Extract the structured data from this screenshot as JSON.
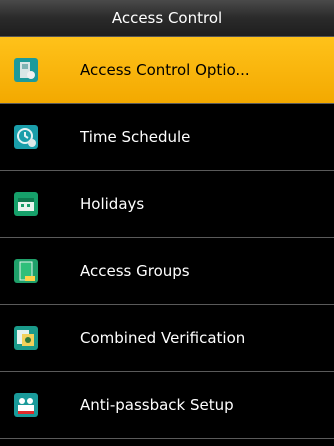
{
  "window": {
    "title": "Access Control"
  },
  "menu": {
    "items": [
      {
        "label": "Access Control Optio...",
        "icon": "access-control-options-icon",
        "selected": true
      },
      {
        "label": "Time Schedule",
        "icon": "time-schedule-icon"
      },
      {
        "label": "Holidays",
        "icon": "holidays-icon"
      },
      {
        "label": "Access Groups",
        "icon": "access-groups-icon"
      },
      {
        "label": "Combined Verification",
        "icon": "combined-verification-icon"
      },
      {
        "label": "Anti-passback Setup",
        "icon": "anti-passback-icon"
      }
    ]
  },
  "colors": {
    "selected_bg": "#f7b500",
    "background": "#000000"
  }
}
